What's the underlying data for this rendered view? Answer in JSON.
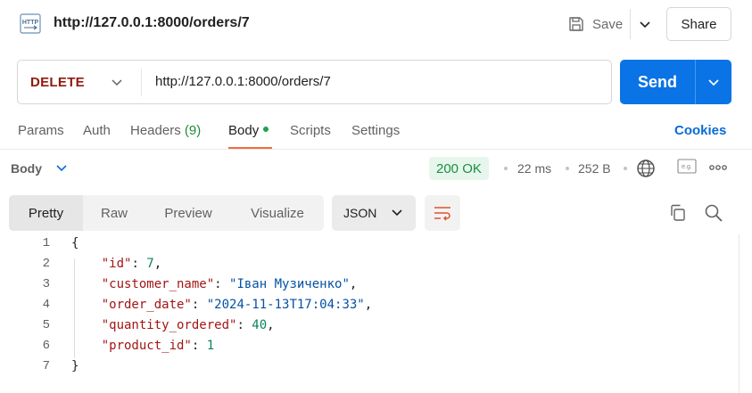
{
  "header": {
    "title": "http://127.0.0.1:8000/orders/7",
    "http_icon_label": "HTTP",
    "save_label": "Save",
    "share_label": "Share"
  },
  "request": {
    "method": "DELETE",
    "url": "http://127.0.0.1:8000/orders/7",
    "send_label": "Send",
    "method_color": "#8e1a10"
  },
  "tabs": {
    "params": "Params",
    "auth": "Auth",
    "headers": "Headers",
    "headers_count": "(9)",
    "body": "Body",
    "scripts": "Scripts",
    "settings": "Settings",
    "cookies": "Cookies"
  },
  "response": {
    "section_label": "Body",
    "status": "200 OK",
    "time": "22 ms",
    "size": "252 B",
    "eg_label": "e.g."
  },
  "view": {
    "options": [
      "Pretty",
      "Raw",
      "Preview",
      "Visualize"
    ],
    "active": "Pretty",
    "format": "JSON"
  },
  "code": {
    "line_numbers": [
      "1",
      "2",
      "3",
      "4",
      "5",
      "6",
      "7"
    ],
    "open_brace": "{",
    "close_brace": "}",
    "fields": [
      {
        "key": "\"id\"",
        "value": "7",
        "type": "num",
        "comma": ","
      },
      {
        "key": "\"customer_name\"",
        "value": "\"Іван Музиченко\"",
        "type": "str",
        "comma": ","
      },
      {
        "key": "\"order_date\"",
        "value": "\"2024-11-13T17:04:33\"",
        "type": "str",
        "comma": ","
      },
      {
        "key": "\"quantity_ordered\"",
        "value": "40",
        "type": "num",
        "comma": ","
      },
      {
        "key": "\"product_id\"",
        "value": "1",
        "type": "num",
        "comma": ""
      }
    ]
  },
  "colors": {
    "accent_blue": "#0a73e6",
    "status_green": "#1a8f3f",
    "tab_underline": "#f26b3a"
  }
}
